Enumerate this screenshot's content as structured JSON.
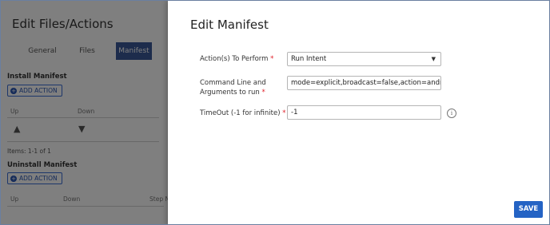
{
  "background": {
    "title": "Edit Files/Actions",
    "tabs": [
      "General",
      "Files",
      "Manifest"
    ],
    "install": {
      "heading": "Install Manifest",
      "add_label": "ADD ACTION",
      "columns": [
        "Up",
        "Down"
      ],
      "items_text": "Items: 1-1 of 1"
    },
    "uninstall": {
      "heading": "Uninstall Manifest",
      "add_label": "ADD ACTION",
      "columns": [
        "Up",
        "Down",
        "Step N"
      ]
    }
  },
  "modal": {
    "title": "Edit Manifest",
    "fields": {
      "action": {
        "label": "Action(s) To Perform",
        "value": "Run Intent"
      },
      "command": {
        "label_line1": "Command Line and",
        "label_line2": "Arguments to run",
        "value": "mode=explicit,broadcast=false,action=android.intent"
      },
      "timeout": {
        "label": "TimeOut (-1 for infinite)",
        "value": "-1"
      }
    },
    "required_mark": "*",
    "info_glyph": "i",
    "save_label": "SAVE"
  },
  "colors": {
    "accent": "#2463c4",
    "required": "#e0202a",
    "active_tab": "#3b5998"
  }
}
